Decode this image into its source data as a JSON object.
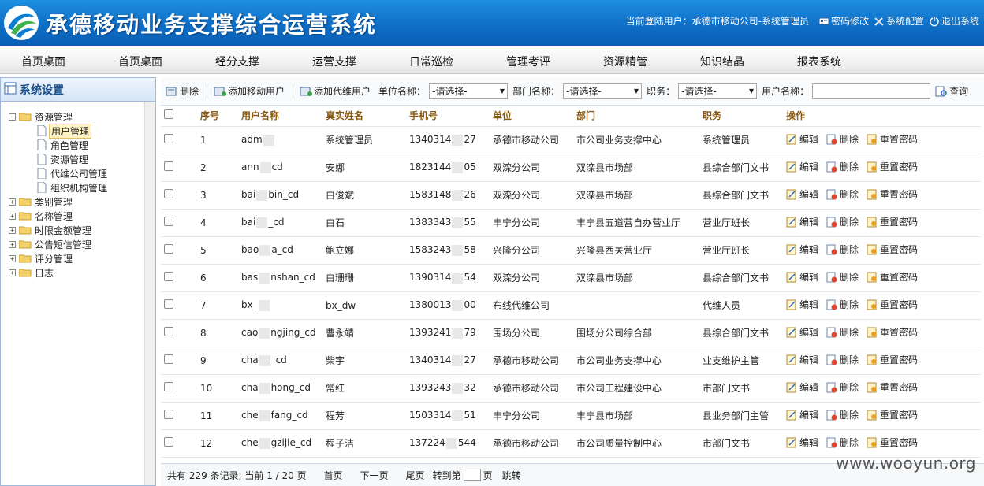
{
  "header": {
    "title": "承德移动业务支撑综合运营系统",
    "current_user": "当前登陆用户：承德市移动公司-系统管理员",
    "links": [
      {
        "label": "密码修改",
        "icon": "key-card-icon"
      },
      {
        "label": "系统配置",
        "icon": "tools-icon"
      },
      {
        "label": "退出系统",
        "icon": "exit-icon"
      }
    ]
  },
  "nav": [
    "首页桌面",
    "首页桌面",
    "经分支撑",
    "运营支撑",
    "日常巡检",
    "管理考评",
    "资源精管",
    "知识结晶",
    "报表系统"
  ],
  "sidebar": {
    "title": "系统设置",
    "tree": [
      {
        "label": "资源管理",
        "expanded": true,
        "children": [
          "用户管理",
          "角色管理",
          "资源管理",
          "代维公司管理",
          "组织机构管理"
        ]
      },
      {
        "label": "类别管理"
      },
      {
        "label": "名称管理"
      },
      {
        "label": "时限金额管理"
      },
      {
        "label": "公告短信管理"
      },
      {
        "label": "评分管理"
      },
      {
        "label": "日志"
      }
    ],
    "selected": "用户管理"
  },
  "toolbar": {
    "delete_label": "删除",
    "add_mobile_label": "添加移动用户",
    "add_agent_label": "添加代维用户",
    "unit_label": "单位名称：",
    "dept_label": "部门名称：",
    "position_label": "职务：",
    "username_label": "用户名称：",
    "select_placeholder": "-请选择-",
    "query_label": "查询"
  },
  "table": {
    "headers": [
      "序号",
      "用户名称",
      "真实姓名",
      "手机号",
      "单位",
      "部门",
      "职务",
      "操作"
    ],
    "ops": {
      "edit": "编辑",
      "delete": "删除",
      "reset": "重置密码"
    },
    "rows": [
      {
        "no": "1",
        "user": [
          "adm",
          ""
        ],
        "name": "系统管理员",
        "phone": [
          "1340314",
          "27"
        ],
        "unit": "承德市移动公司",
        "dept": "市公司业务支撑中心",
        "pos": "系统管理员"
      },
      {
        "no": "2",
        "user": [
          "ann",
          "cd"
        ],
        "name": "安娜",
        "phone": [
          "1823144",
          "05"
        ],
        "unit": "双滦分公司",
        "dept": "双滦县市场部",
        "pos": "县综合部门文书"
      },
      {
        "no": "3",
        "user": [
          "bai",
          "bin_cd"
        ],
        "name": "白俊斌",
        "phone": [
          "1583148",
          "26"
        ],
        "unit": "双滦分公司",
        "dept": "双滦县市场部",
        "pos": "县综合部门文书"
      },
      {
        "no": "4",
        "user": [
          "bai",
          "_cd"
        ],
        "name": "白石",
        "phone": [
          "1383343",
          "55"
        ],
        "unit": "丰宁分公司",
        "dept": "丰宁县五道营自办营业厅",
        "pos": "营业厅班长"
      },
      {
        "no": "5",
        "user": [
          "bao",
          "a_cd"
        ],
        "name": "鲍立娜",
        "phone": [
          "1583243",
          "58"
        ],
        "unit": "兴隆分公司",
        "dept": "兴隆县西关营业厅",
        "pos": "营业厅班长"
      },
      {
        "no": "6",
        "user": [
          "bas",
          "nshan_cd"
        ],
        "name": "白珊珊",
        "phone": [
          "1390314",
          "54"
        ],
        "unit": "双滦分公司",
        "dept": "双滦县市场部",
        "pos": "县综合部门文书"
      },
      {
        "no": "7",
        "user": [
          "bx_",
          ""
        ],
        "name": "bx_dw",
        "phone": [
          "1380013",
          "00"
        ],
        "unit": "布线代维公司",
        "dept": "",
        "pos": "代维人员"
      },
      {
        "no": "8",
        "user": [
          "cao",
          "ngjing_cd"
        ],
        "name": "曹永靖",
        "phone": [
          "1393241",
          "79"
        ],
        "unit": "围场分公司",
        "dept": "围场分公司综合部",
        "pos": "县综合部门文书"
      },
      {
        "no": "9",
        "user": [
          "cha",
          "_cd"
        ],
        "name": "柴宇",
        "phone": [
          "1340314",
          "27"
        ],
        "unit": "承德市移动公司",
        "dept": "市公司业务支撑中心",
        "pos": "业支维护主管"
      },
      {
        "no": "10",
        "user": [
          "cha",
          "hong_cd"
        ],
        "name": "常红",
        "phone": [
          "1393243",
          "32"
        ],
        "unit": "承德市移动公司",
        "dept": "市公司工程建设中心",
        "pos": "市部门文书"
      },
      {
        "no": "11",
        "user": [
          "che",
          "fang_cd"
        ],
        "name": "程芳",
        "phone": [
          "1503314",
          "51"
        ],
        "unit": "丰宁分公司",
        "dept": "丰宁县市场部",
        "pos": "县业务部门主管"
      },
      {
        "no": "12",
        "user": [
          "che",
          "gzijie_cd"
        ],
        "name": "程子洁",
        "phone": [
          "137224",
          "544"
        ],
        "unit": "承德市移动公司",
        "dept": "市公司质量控制中心",
        "pos": "市部门文书"
      }
    ]
  },
  "footer": {
    "summary": "共有 229 条记录; 当前 1 / 20 页",
    "first": "首页",
    "next": "下一页",
    "last": "尾页",
    "goto_prefix": "转到第",
    "goto_suffix": "页",
    "jump": "跳转"
  },
  "watermark": "www.wooyun.org"
}
